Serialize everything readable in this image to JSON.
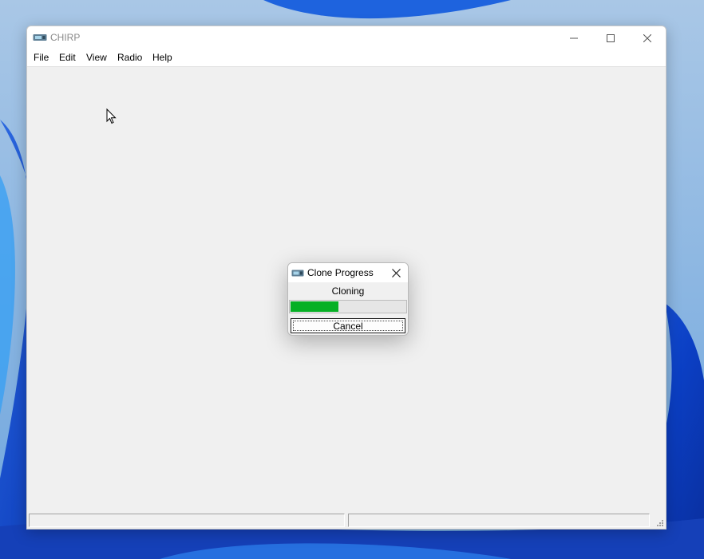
{
  "window": {
    "title": "CHIRP",
    "icon": "radio-icon",
    "controls": [
      "minimize-icon",
      "maximize-icon",
      "close-icon"
    ]
  },
  "menu": {
    "items": [
      {
        "label": "File"
      },
      {
        "label": "Edit"
      },
      {
        "label": "View"
      },
      {
        "label": "Radio"
      },
      {
        "label": "Help"
      }
    ]
  },
  "dialog": {
    "title": "Clone Progress",
    "icon": "radio-icon",
    "status": "Cloning",
    "progress_percent": 42,
    "cancel_label": "Cancel",
    "progress_color": "#06b025"
  },
  "statusbar": {
    "panes": [
      "",
      ""
    ]
  }
}
